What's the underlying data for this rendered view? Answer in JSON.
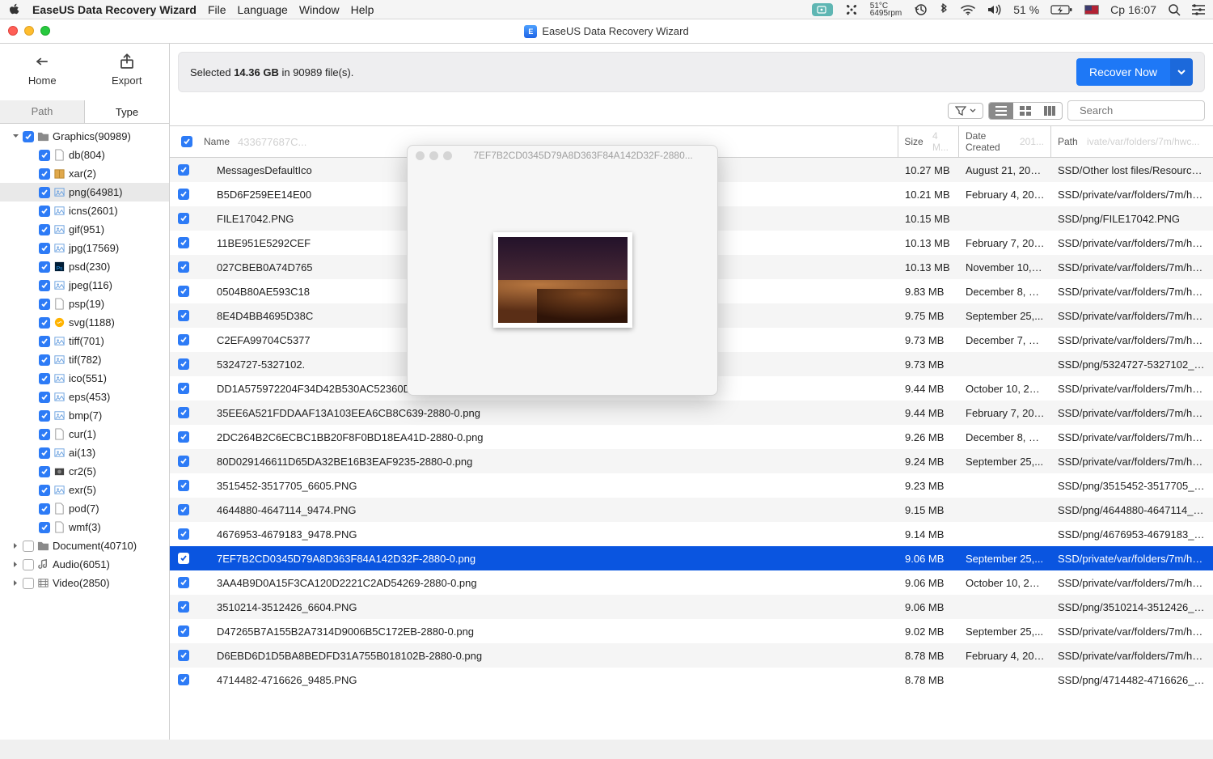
{
  "menubar": {
    "app_name": "EaseUS Data Recovery Wizard",
    "items": [
      "File",
      "Language",
      "Window",
      "Help"
    ],
    "status_temp": "51°C",
    "status_rpm": "6495rpm",
    "battery_pct": "51 %",
    "clock": "Ср 16:07"
  },
  "window": {
    "title": "EaseUS Data Recovery Wizard"
  },
  "toolbar": {
    "home": "Home",
    "export": "Export"
  },
  "banner": {
    "pre": "Selected ",
    "bold": "14.36 GB",
    "post": " in 90989 file(s).",
    "recover": "Recover Now"
  },
  "tabs": {
    "path": "Path",
    "type": "Type"
  },
  "tree": {
    "items": [
      {
        "level": 0,
        "icon": "folder",
        "label": "Graphics(90989)",
        "disclose": "open"
      },
      {
        "level": 1,
        "icon": "file",
        "label": "db(804)"
      },
      {
        "level": 1,
        "icon": "archive",
        "label": "xar(2)"
      },
      {
        "level": 1,
        "icon": "image",
        "label": "png(64981)",
        "selected": true
      },
      {
        "level": 1,
        "icon": "image",
        "label": "icns(2601)"
      },
      {
        "level": 1,
        "icon": "image",
        "label": "gif(951)"
      },
      {
        "level": 1,
        "icon": "image",
        "label": "jpg(17569)"
      },
      {
        "level": 1,
        "icon": "psd",
        "label": "psd(230)"
      },
      {
        "level": 1,
        "icon": "image",
        "label": "jpeg(116)"
      },
      {
        "level": 1,
        "icon": "file",
        "label": "psp(19)"
      },
      {
        "level": 1,
        "icon": "svg",
        "label": "svg(1188)"
      },
      {
        "level": 1,
        "icon": "image",
        "label": "tiff(701)"
      },
      {
        "level": 1,
        "icon": "image",
        "label": "tif(782)"
      },
      {
        "level": 1,
        "icon": "image",
        "label": "ico(551)"
      },
      {
        "level": 1,
        "icon": "image",
        "label": "eps(453)"
      },
      {
        "level": 1,
        "icon": "image",
        "label": "bmp(7)"
      },
      {
        "level": 1,
        "icon": "file",
        "label": "cur(1)"
      },
      {
        "level": 1,
        "icon": "image",
        "label": "ai(13)"
      },
      {
        "level": 1,
        "icon": "cr2",
        "label": "cr2(5)"
      },
      {
        "level": 1,
        "icon": "image",
        "label": "exr(5)"
      },
      {
        "level": 1,
        "icon": "file",
        "label": "pod(7)"
      },
      {
        "level": 1,
        "icon": "file",
        "label": "wmf(3)"
      },
      {
        "level": 0,
        "icon": "folder",
        "label": "Document(40710)",
        "disclose": "closed",
        "checked": false
      },
      {
        "level": 0,
        "icon": "audio",
        "label": "Audio(6051)",
        "disclose": "closed",
        "checked": false
      },
      {
        "level": 0,
        "icon": "video",
        "label": "Video(2850)",
        "disclose": "closed",
        "checked": false
      }
    ]
  },
  "columns": {
    "name": "Name",
    "size": "Size",
    "date": "Date Created",
    "path": "Path"
  },
  "ghost": {
    "name": "433677687C...",
    "size": "4 M...",
    "date": "201...",
    "path": "ivate/var/folders/7m/hwc..."
  },
  "rows": [
    {
      "name": "MessagesDefaultIco",
      "size": "10.27 MB",
      "date": "August 21, 201...",
      "path": "SSD/Other lost files/Resources/..."
    },
    {
      "name": "B5D6F259EE14E00",
      "size": "10.21 MB",
      "date": "February 4, 201...",
      "path": "SSD/private/var/folders/7m/hwc..."
    },
    {
      "name": "FILE17042.PNG",
      "size": "10.15 MB",
      "date": "",
      "path": "SSD/png/FILE17042.PNG"
    },
    {
      "name": "11BE951E5292CEF",
      "size": "10.13 MB",
      "date": "February 7, 201...",
      "path": "SSD/private/var/folders/7m/hwc..."
    },
    {
      "name": "027CBEB0A74D765",
      "size": "10.13 MB",
      "date": "November 10, 2...",
      "path": "SSD/private/var/folders/7m/hwc..."
    },
    {
      "name": "0504B80AE593C18",
      "size": "9.83 MB",
      "date": "December 8, 20...",
      "path": "SSD/private/var/folders/7m/hwc..."
    },
    {
      "name": "8E4D4BB4695D38C",
      "size": "9.75 MB",
      "date": "September 25,...",
      "path": "SSD/private/var/folders/7m/hwc..."
    },
    {
      "name": "C2EFA99704C5377",
      "size": "9.73 MB",
      "date": "December 7, 20...",
      "path": "SSD/private/var/folders/7m/hwc..."
    },
    {
      "name": "5324727-5327102.",
      "size": "9.73 MB",
      "date": "",
      "path": "SSD/png/5324727-5327102_1..."
    },
    {
      "name": "DD1A575972204F34D42B530AC52360D8-2880-0.png",
      "size": "9.44 MB",
      "date": "October 10, 201...",
      "path": "SSD/private/var/folders/7m/hwc..."
    },
    {
      "name": "35EE6A521FDDAAF13A103EEA6CB8C639-2880-0.png",
      "size": "9.44 MB",
      "date": "February 7, 201...",
      "path": "SSD/private/var/folders/7m/hwc..."
    },
    {
      "name": "2DC264B2C6ECBC1BB20F8F0BD18EA41D-2880-0.png",
      "size": "9.26 MB",
      "date": "December 8, 20...",
      "path": "SSD/private/var/folders/7m/hwc..."
    },
    {
      "name": "80D029146611D65DA32BE16B3EAF9235-2880-0.png",
      "size": "9.24 MB",
      "date": "September 25,...",
      "path": "SSD/private/var/folders/7m/hwc..."
    },
    {
      "name": "3515452-3517705_6605.PNG",
      "size": "9.23 MB",
      "date": "",
      "path": "SSD/png/3515452-3517705_6..."
    },
    {
      "name": "4644880-4647114_9474.PNG",
      "size": "9.15 MB",
      "date": "",
      "path": "SSD/png/4644880-4647114_9..."
    },
    {
      "name": "4676953-4679183_9478.PNG",
      "size": "9.14 MB",
      "date": "",
      "path": "SSD/png/4676953-4679183_9..."
    },
    {
      "name": "7EF7B2CD0345D79A8D363F84A142D32F-2880-0.png",
      "size": "9.06 MB",
      "date": "September 25,...",
      "path": "SSD/private/var/folders/7m/hwc...",
      "selected": true
    },
    {
      "name": "3AA4B9D0A15F3CA120D2221C2AD54269-2880-0.png",
      "size": "9.06 MB",
      "date": "October 10, 201...",
      "path": "SSD/private/var/folders/7m/hwc..."
    },
    {
      "name": "3510214-3512426_6604.PNG",
      "size": "9.06 MB",
      "date": "",
      "path": "SSD/png/3510214-3512426_6..."
    },
    {
      "name": "D47265B7A155B2A7314D9006B5C172EB-2880-0.png",
      "size": "9.02 MB",
      "date": "September 25,...",
      "path": "SSD/private/var/folders/7m/hwc..."
    },
    {
      "name": "D6EBD6D1D5BA8BEDFD31A755B018102B-2880-0.png",
      "size": "8.78 MB",
      "date": "February 4, 201...",
      "path": "SSD/private/var/folders/7m/hwc..."
    },
    {
      "name": "4714482-4716626_9485.PNG",
      "size": "8.78 MB",
      "date": "",
      "path": "SSD/png/4714482-4716626_9..."
    }
  ],
  "preview": {
    "title": "7EF7B2CD0345D79A8D363F84A142D32F-2880..."
  },
  "search": {
    "placeholder": "Search"
  }
}
